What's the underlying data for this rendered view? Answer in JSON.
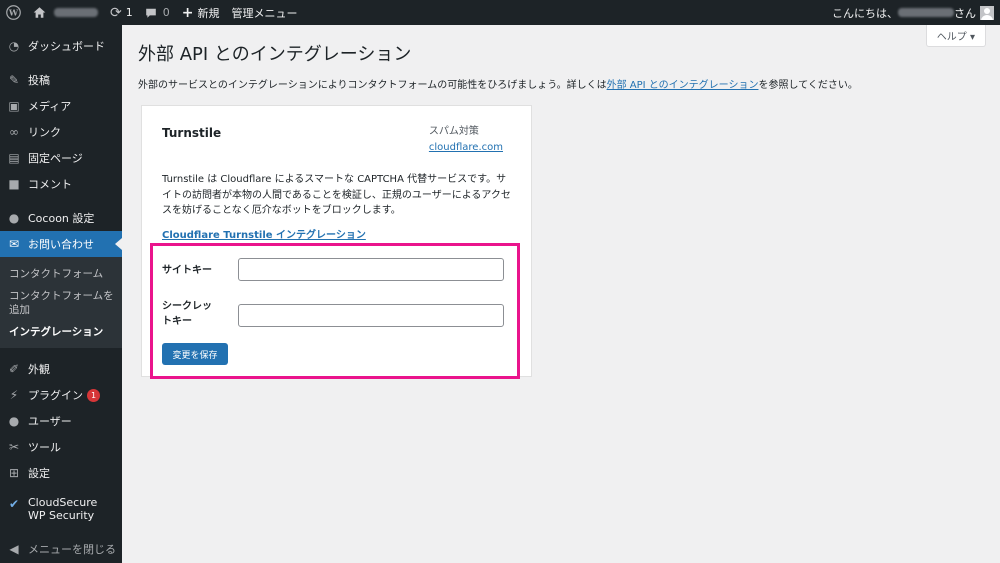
{
  "adminbar": {
    "updates_count": "1",
    "comments_count": "0",
    "new_label": "新規",
    "admin_menu_label": "管理メニュー",
    "greeting": "こんにちは、",
    "greeting_suffix": "さん"
  },
  "sidebar": {
    "dashboard": "ダッシュボード",
    "posts": "投稿",
    "media": "メディア",
    "links": "リンク",
    "pages": "固定ページ",
    "comments": "コメント",
    "cocoon": "Cocoon 設定",
    "contact": "お問い合わせ",
    "sub_contact_forms": "コンタクトフォーム",
    "sub_add_form": "コンタクトフォームを追加",
    "sub_integration": "インテグレーション",
    "appearance": "外観",
    "plugins": "プラグイン",
    "plugins_badge": "1",
    "users": "ユーザー",
    "tools": "ツール",
    "settings": "設定",
    "cloudsecure": "CloudSecure WP Security",
    "collapse": "メニューを閉じる"
  },
  "main": {
    "help_label": "ヘルプ ▾",
    "title": "外部 API とのインテグレーション",
    "intro_text": "外部のサービスとのインテグレーションによりコンタクトフォームの可能性をひろげましょう。詳しくは",
    "intro_link": "外部 API とのインテグレーション",
    "intro_suffix": "を参照してください。"
  },
  "card": {
    "title": "Turnstile",
    "category": "スパム対策",
    "category_link": "cloudflare.com",
    "description": "Turnstile は Cloudflare によるスマートな CAPTCHA 代替サービスです。サイトの訪問者が本物の人間であることを検証し、正規のユーザーによるアクセスを妨げることなく厄介なボットをブロックします。",
    "integration_link": "Cloudflare Turnstile インテグレーション",
    "site_key_label": "サイトキー",
    "secret_key_label_1": "シークレッ",
    "secret_key_label_2": "トキー",
    "site_key_value": "",
    "secret_key_value": "",
    "save_label": "変更を保存"
  },
  "colors": {
    "accent": "#2271b1",
    "highlight": "#ea148c",
    "sidebar_bg": "#1d2327"
  }
}
